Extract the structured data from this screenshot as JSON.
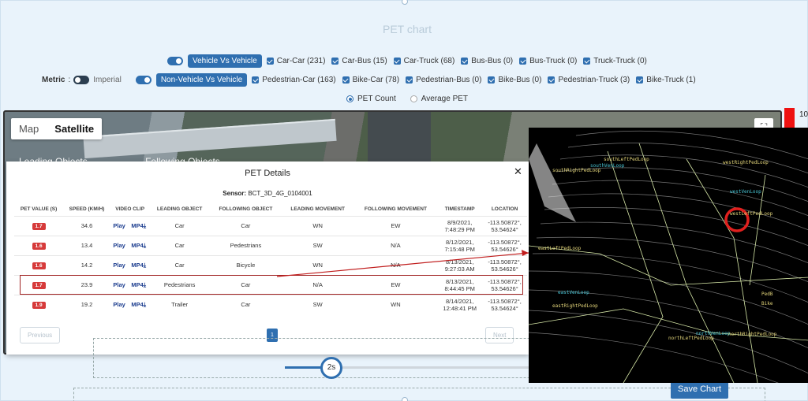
{
  "page": {
    "title": "PET chart"
  },
  "metric": {
    "label": "Metric",
    "unit": "Imperial"
  },
  "vehicle": {
    "toggle_label": "Vehicle Vs Vehicle",
    "items": [
      "Car-Car (231)",
      "Car-Bus (15)",
      "Car-Truck (68)",
      "Bus-Bus (0)",
      "Bus-Truck (0)",
      "Truck-Truck (0)"
    ]
  },
  "nonvehicle": {
    "toggle_label": "Non-Vehicle Vs Vehicle",
    "items": [
      "Pedestrian-Car (163)",
      "Bike-Car (78)",
      "Pedestrian-Bus (0)",
      "Bike-Bus (0)",
      "Pedestrian-Truck (3)",
      "Bike-Truck (1)"
    ]
  },
  "radios": {
    "pet_count": "PET Count",
    "average_pet": "Average PET",
    "selected": "PET Count"
  },
  "map": {
    "map_tab": "Map",
    "satellite_tab": "Satellite",
    "selected": "Satellite",
    "strip_left": "Leading Objects",
    "strip_right": "Following Objects"
  },
  "legend": {
    "top_value": "10",
    "color": "#e11111"
  },
  "modal": {
    "title": "PET Details",
    "sensor_label": "Sensor:",
    "sensor_value": "BCT_3D_4G_0104001",
    "columns": [
      "PET VALUE (s)",
      "SPEED (km/h)",
      "VIDEO CLIP",
      "LEADING OBJECT",
      "FOLLOWING OBJECT",
      "LEADING MOVEMENT",
      "FOLLOWING MOVEMENT",
      "TIMESTAMP",
      "LOCATION"
    ],
    "rows": [
      {
        "pet": "1.7",
        "speed": "34.6",
        "play": "Play",
        "mp4": "MP4⤓",
        "leading": "Car",
        "following": "Car",
        "lead_move": "WN",
        "follow_move": "EW",
        "ts1": "8/9/2021,",
        "ts2": "7:48:29 PM",
        "loc1": "-113.50872°,",
        "loc2": "53.54624°"
      },
      {
        "pet": "1.6",
        "speed": "13.4",
        "play": "Play",
        "mp4": "MP4⤓",
        "leading": "Car",
        "following": "Pedestrians",
        "lead_move": "SW",
        "follow_move": "N/A",
        "ts1": "8/12/2021,",
        "ts2": "7:15:48 PM",
        "loc1": "-113.50872°,",
        "loc2": "53.54626°"
      },
      {
        "pet": "1.6",
        "speed": "14.2",
        "play": "Play",
        "mp4": "MP4⤓",
        "leading": "Car",
        "following": "Bicycle",
        "lead_move": "WN",
        "follow_move": "N/A",
        "ts1": "8/13/2021,",
        "ts2": "9:27:03 AM",
        "loc1": "-113.50872°,",
        "loc2": "53.54626°"
      },
      {
        "pet": "1.7",
        "speed": "23.9",
        "play": "Play",
        "mp4": "MP4⤓",
        "leading": "Pedestrians",
        "following": "Car",
        "lead_move": "N/A",
        "follow_move": "EW",
        "ts1": "8/13/2021,",
        "ts2": "8:44:45 PM",
        "loc1": "-113.50872°,",
        "loc2": "53.54626°"
      },
      {
        "pet": "1.9",
        "speed": "19.2",
        "play": "Play",
        "mp4": "MP4⤓",
        "leading": "Trailer",
        "following": "Car",
        "lead_move": "SW",
        "follow_move": "WN",
        "ts1": "8/14/2021,",
        "ts2": "12:48:41 PM",
        "loc1": "-113.50872°,",
        "loc2": "53.54624°"
      }
    ],
    "highlighted_row": 3,
    "pagination": {
      "previous": "Previous",
      "page": "1",
      "next": "Next"
    }
  },
  "slider": {
    "value_label": "2s",
    "fraction": 0.18
  },
  "save_button": "Save Chart",
  "lidar": {
    "labels": [
      "southLeftPedLoop",
      "southVenLoop",
      "southRightPedLoop",
      "westRightPedLoop",
      "westVenLoop",
      "westLeftPedLoop",
      "eastLeftPedLoop",
      "eastVenLoop",
      "eastRightPedLoop",
      "northVenLoop",
      "northLeftPedLoop",
      "northRightPedLoop",
      "PedB",
      "Bike"
    ]
  }
}
